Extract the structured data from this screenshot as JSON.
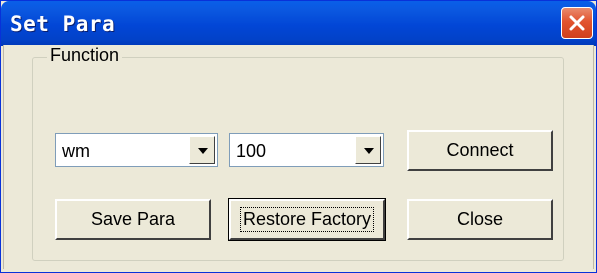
{
  "window": {
    "title": "Set Para"
  },
  "group": {
    "legend": "Function"
  },
  "controls": {
    "mode_select": {
      "value": "wm"
    },
    "value_select": {
      "value": "100"
    },
    "connect_label": "Connect",
    "save_label": "Save Para",
    "restore_label": "Restore Factory",
    "close_label": "Close"
  },
  "colors": {
    "titlebar": "#0246d6",
    "close_button": "#e2542f",
    "dialog_face": "#ece9d8"
  },
  "icons": {
    "close": "close-icon",
    "dropdown": "chevron-down-icon"
  }
}
